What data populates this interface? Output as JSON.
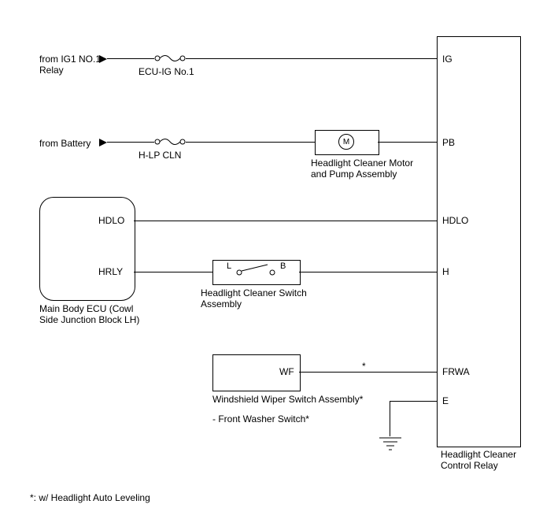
{
  "sources": {
    "ig1_relay": "from IG1 NO.1\nRelay",
    "battery": "from Battery"
  },
  "fuses": {
    "ecu_ig": "ECU-IG No.1",
    "hlp_cln": "H-LP CLN"
  },
  "components": {
    "motor": "Headlight Cleaner Motor\nand Pump Assembly",
    "main_ecu": "Main Body ECU (Cowl\nSide Junction Block LH)",
    "cleaner_switch": "Headlight Cleaner Switch\nAssembly",
    "wiper_switch": "Windshield Wiper Switch Assembly*",
    "wiper_sub": "- Front Washer Switch*",
    "control_relay": "Headlight Cleaner\nControl Relay"
  },
  "pins": {
    "ig": "IG",
    "pb": "PB",
    "hdlo_left": "HDLO",
    "hdlo_right": "HDLO",
    "hrly": "HRLY",
    "h": "H",
    "frwa": "FRWA",
    "e": "E",
    "wf": "WF",
    "l": "L",
    "b": "B",
    "m": "M"
  },
  "notes": {
    "asterisk": "*",
    "footnote": "*: w/ Headlight Auto Leveling"
  }
}
